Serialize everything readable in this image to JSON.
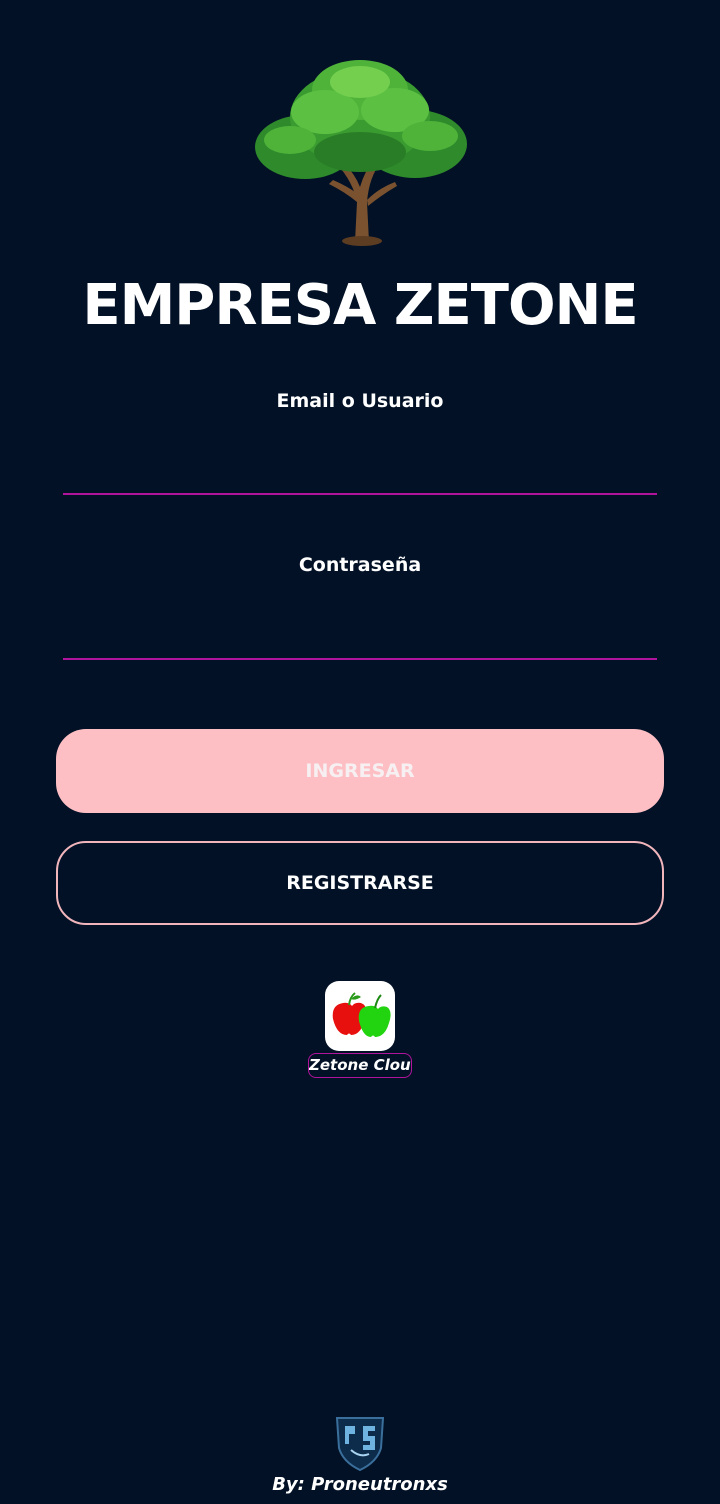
{
  "header": {
    "logo_icon": "tree-icon",
    "title": "EMPRESA ZETONE"
  },
  "login_form": {
    "email_label": "Email o Usuario",
    "email_value": "",
    "password_label": "Contraseña",
    "password_value": "",
    "login_button": "INGRESAR",
    "register_button": "REGISTRARSE"
  },
  "cloud_app": {
    "icon": "apples-icon",
    "label": "Zetone Cloud"
  },
  "footer": {
    "logo_icon": "proneutronxs-logo-icon",
    "credit": "By: Proneutronxs"
  },
  "colors": {
    "background": "#021126",
    "accent_underline": "#b0149c",
    "login_button_bg": "#fdbfc4",
    "register_border": "#f1b6bc"
  }
}
